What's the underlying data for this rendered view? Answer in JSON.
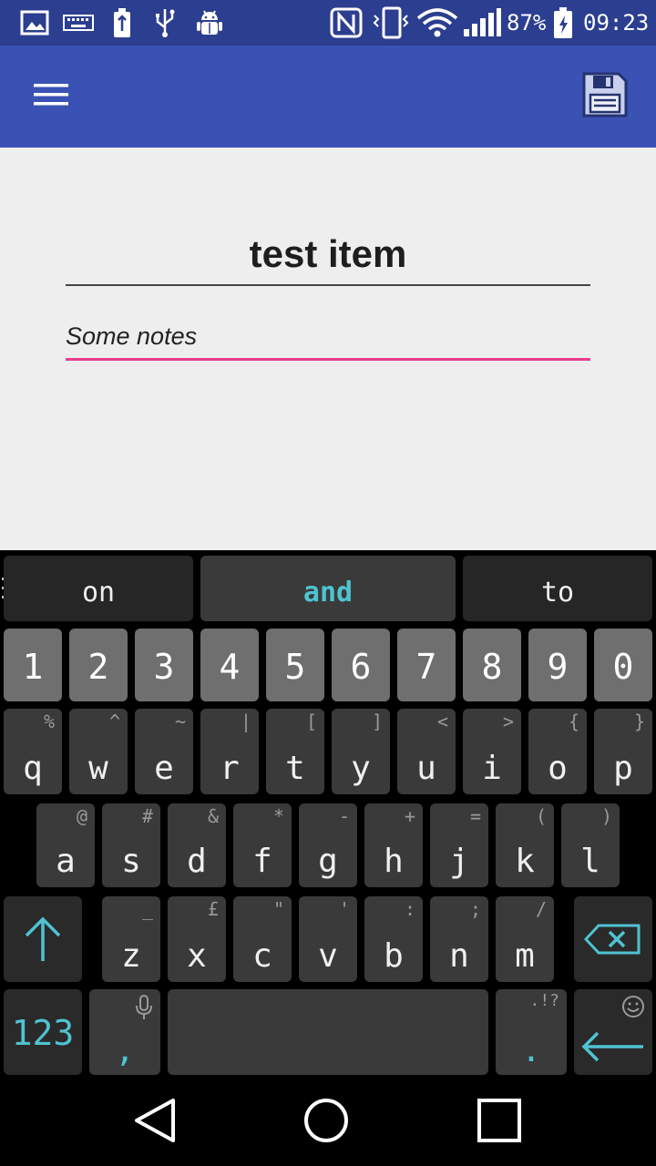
{
  "status_bar": {
    "battery_percent": "87%",
    "time": "09:23",
    "icons": [
      "gallery-icon",
      "keyboard-icon",
      "usb-battery-icon",
      "usb-icon",
      "android-debug-icon",
      "nfc-icon",
      "vibrate-icon",
      "wifi-icon",
      "signal-icon",
      "battery-charging-icon"
    ]
  },
  "app_bar": {
    "menu_icon": "hamburger-menu-icon",
    "save_icon": "floppy-disk-icon",
    "color": "#3a52b4"
  },
  "form": {
    "title_value": "test item",
    "notes_value": "Some notes",
    "accent_color": "#e83e8c"
  },
  "keyboard": {
    "suggestions": [
      "on",
      "and",
      "to"
    ],
    "number_row": [
      "1",
      "2",
      "3",
      "4",
      "5",
      "6",
      "7",
      "8",
      "9",
      "0"
    ],
    "row1": [
      {
        "main": "q",
        "hint": "%"
      },
      {
        "main": "w",
        "hint": "^"
      },
      {
        "main": "e",
        "hint": "~"
      },
      {
        "main": "r",
        "hint": "|"
      },
      {
        "main": "t",
        "hint": "["
      },
      {
        "main": "y",
        "hint": "]"
      },
      {
        "main": "u",
        "hint": "<"
      },
      {
        "main": "i",
        "hint": ">"
      },
      {
        "main": "o",
        "hint": "{"
      },
      {
        "main": "p",
        "hint": "}"
      }
    ],
    "row2": [
      {
        "main": "a",
        "hint": "@"
      },
      {
        "main": "s",
        "hint": "#"
      },
      {
        "main": "d",
        "hint": "&"
      },
      {
        "main": "f",
        "hint": "*"
      },
      {
        "main": "g",
        "hint": "-"
      },
      {
        "main": "h",
        "hint": "+"
      },
      {
        "main": "j",
        "hint": "="
      },
      {
        "main": "k",
        "hint": "("
      },
      {
        "main": "l",
        "hint": ")"
      }
    ],
    "row3": [
      {
        "main": "z",
        "hint": "_"
      },
      {
        "main": "x",
        "hint": "£"
      },
      {
        "main": "c",
        "hint": "\""
      },
      {
        "main": "v",
        "hint": "'"
      },
      {
        "main": "b",
        "hint": ":"
      },
      {
        "main": "n",
        "hint": ";"
      },
      {
        "main": "m",
        "hint": "/"
      }
    ],
    "bottom": {
      "numbers_label": "123",
      "comma": ",",
      "comma_hint_icon": "microphone-icon",
      "period": ".",
      "period_hint": ".!?",
      "enter_hint_icon": "smiley-icon"
    },
    "accent_color": "#4fc3d1"
  },
  "nav_bar": {
    "icons": [
      "back-triangle-icon",
      "home-circle-icon",
      "recents-square-icon"
    ]
  }
}
